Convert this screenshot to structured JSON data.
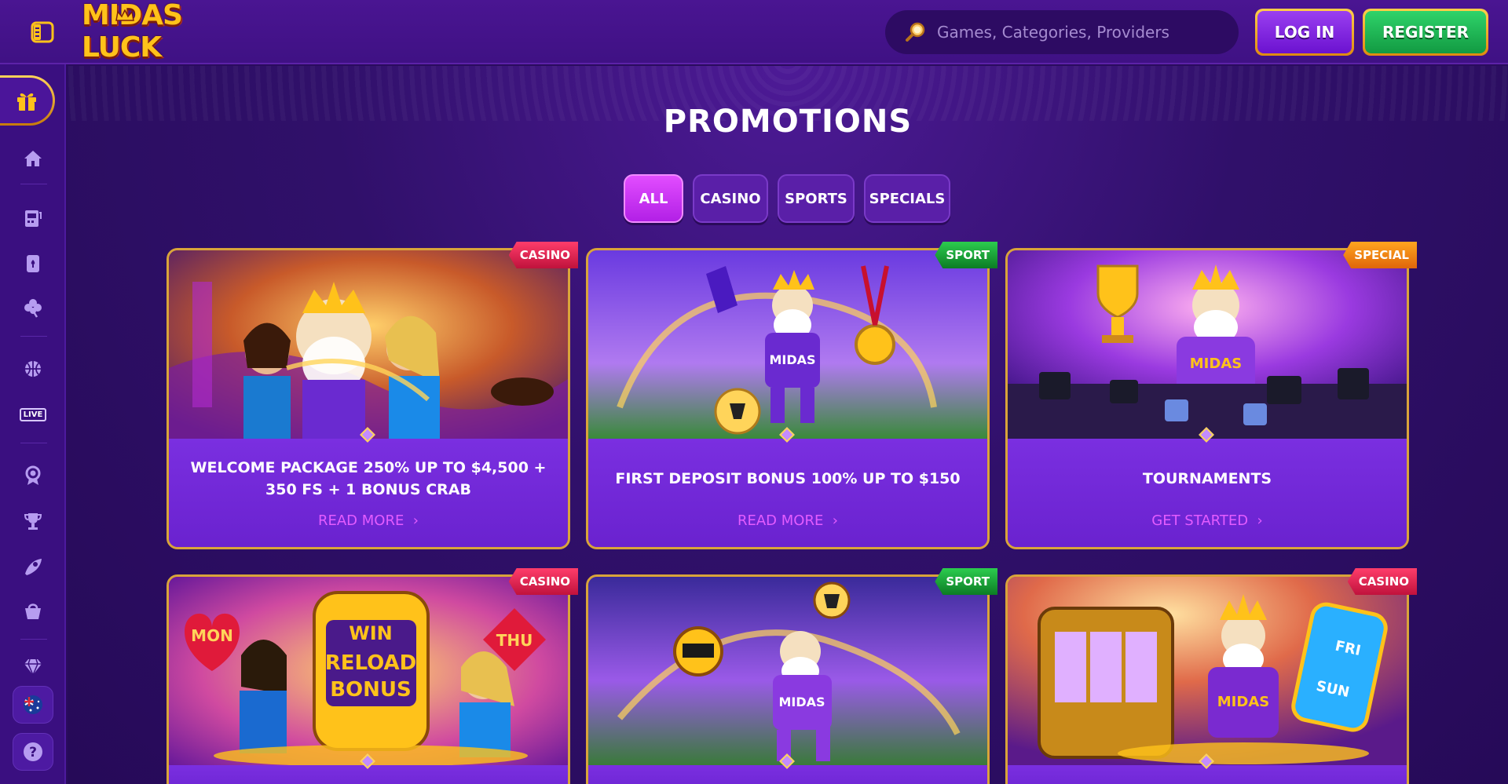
{
  "header": {
    "logo_text": "MIDAS LUCK",
    "search_placeholder": "Games, Categories, Providers",
    "login_label": "LOG IN",
    "register_label": "REGISTER"
  },
  "sidebar": {
    "items": [
      {
        "icon": "gift-icon",
        "active": true
      },
      {
        "icon": "home-icon"
      },
      {
        "icon": "slot-machine-icon"
      },
      {
        "icon": "cards-icon"
      },
      {
        "icon": "clover-icon"
      },
      {
        "icon": "sports-ball-icon"
      },
      {
        "icon": "live-icon",
        "label": "LIVE"
      },
      {
        "icon": "badge-icon"
      },
      {
        "icon": "trophy-icon"
      },
      {
        "icon": "rocket-icon"
      },
      {
        "icon": "shop-basket-icon"
      },
      {
        "icon": "diamond-icon"
      },
      {
        "icon": "australia-flag-icon"
      },
      {
        "icon": "help-icon",
        "label": "?"
      }
    ]
  },
  "page": {
    "title": "PROMOTIONS",
    "tabs": [
      {
        "label": "ALL",
        "active": true
      },
      {
        "label": "CASINO"
      },
      {
        "label": "SPORTS"
      },
      {
        "label": "SPECIALS"
      }
    ]
  },
  "promotions": [
    {
      "tag": "CASINO",
      "title": "WELCOME PACKAGE 250% UP TO $4,500 + 350 FS + 1 BONUS CRAB",
      "link": "READ MORE",
      "art_text": ""
    },
    {
      "tag": "SPORT",
      "title": "FIRST DEPOSIT BONUS 100% UP TO $150",
      "link": "READ MORE",
      "art_text": "MIDAS"
    },
    {
      "tag": "SPECIAL",
      "title": "TOURNAMENTS",
      "link": "GET STARTED",
      "art_text": "MIDAS"
    },
    {
      "tag": "CASINO",
      "title": "",
      "link": "",
      "art_text_lines": [
        "MON",
        "WIN",
        "RELOAD",
        "BONUS",
        "THU"
      ]
    },
    {
      "tag": "SPORT",
      "title": "",
      "link": "",
      "art_text": "MIDAS"
    },
    {
      "tag": "CASINO",
      "title": "",
      "link": "",
      "art_text_lines": [
        "MIDAS",
        "FRI",
        "SUN"
      ]
    }
  ],
  "colors": {
    "accent_pink": "#e45cff",
    "gold": "#d9a43a",
    "register_green": "#2fd36a",
    "casino_red": "#ff3d6b",
    "sport_green": "#2ccc4f",
    "special_orange": "#ffa51f"
  }
}
